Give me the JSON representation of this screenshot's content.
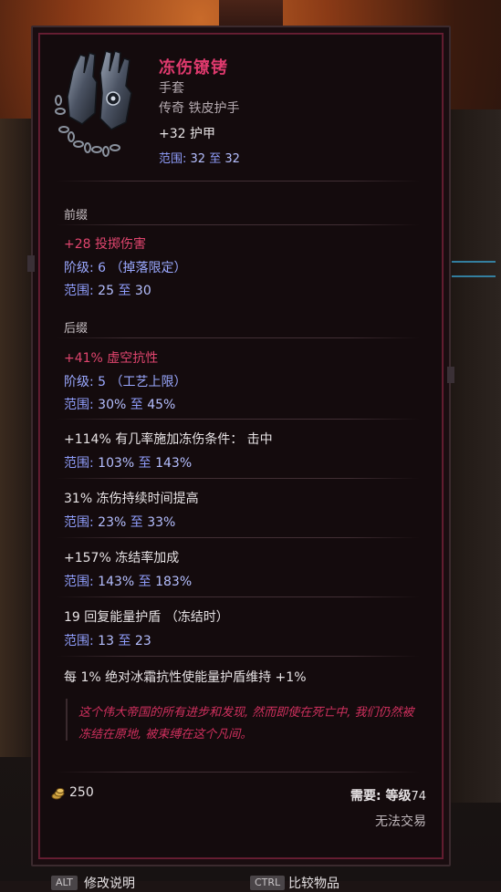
{
  "item": {
    "name": "冻伤镣铐",
    "type": "手套",
    "rarity": "传奇 铁皮护手",
    "implicit": {
      "text": "+32 护甲",
      "range_label": "范围:",
      "range_min": "32",
      "range_to": "至",
      "range_max": "32"
    }
  },
  "prefix": {
    "label": "前缀",
    "mod": "+28 投掷伤害",
    "tier": "阶级: 6 （掉落限定）",
    "range_label": "范围:",
    "range_min": "25",
    "range_to": "至",
    "range_max": "30"
  },
  "suffix": {
    "label": "后缀",
    "mod": "+41% 虚空抗性",
    "tier": "阶级: 5 （工艺上限）",
    "range_label": "范围:",
    "range_min": "30%",
    "range_to": "至",
    "range_max": "45%"
  },
  "uniques": [
    {
      "text": "+114% 有几率施加冻伤条件： 击中",
      "range_label": "范围:",
      "range_min": "103%",
      "range_to": "至",
      "range_max": "143%"
    },
    {
      "text": "31% 冻伤持续时间提高",
      "range_label": "范围:",
      "range_min": "23%",
      "range_to": "至",
      "range_max": "33%"
    },
    {
      "text": "+157% 冻结率加成",
      "range_label": "范围:",
      "range_min": "143%",
      "range_to": "至",
      "range_max": "183%"
    },
    {
      "text": "19 回复能量护盾 （冻结时）",
      "range_label": "范围:",
      "range_min": "13",
      "range_to": "至",
      "range_max": "23"
    }
  ],
  "special_mod": "每 1% 绝对冰霜抗性使能量护盾维持 +1%",
  "lore": "这个伟大帝国的所有进步和发现, 然而即使在死亡中, 我们仍然被冻结在原地, 被束缚在这个凡间。",
  "footer": {
    "gold": "250",
    "requirement_label": "需要: 等级",
    "requirement_level": "74",
    "trade": "无法交易"
  },
  "hints": {
    "alt_key": "ALT",
    "alt_text": "修改说明",
    "ctrl_key": "CTRL",
    "ctrl_text": "比较物品"
  },
  "colors": {
    "unique_name": "#e03a6e",
    "mod_red": "#e0456e",
    "range_blue": "#9aa8ff",
    "panel_border": "#6b1d34"
  }
}
